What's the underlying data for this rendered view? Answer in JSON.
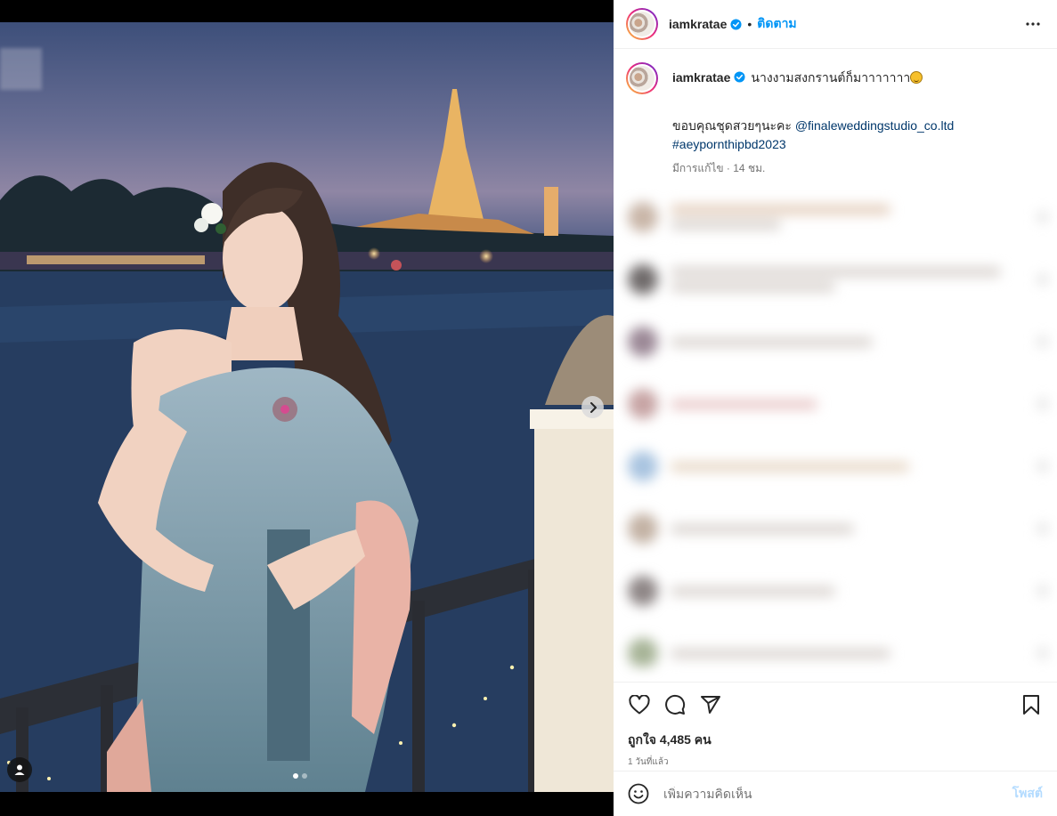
{
  "header": {
    "username": "iamkratae",
    "follow_label": "ติดตาม",
    "more_icon": "more-horizontal-icon"
  },
  "caption": {
    "username": "iamkratae",
    "text": "นางงามสงกรานต์ก็มาาาาาาา",
    "line2_prefix": "ขอบคุณชุดสวยๆนะคะ",
    "mention": "@finaleweddingstudio_co.ltd",
    "hashtag": "#aeypornthipbd2023",
    "meta": "มีการแก้ไข · 14 ชม."
  },
  "actions": {
    "icons": [
      "heart-icon",
      "comment-icon",
      "share-icon",
      "bookmark-icon"
    ],
    "likes": "ถูกใจ 4,485 คน",
    "time": "1 วันที่แล้ว"
  },
  "composer": {
    "placeholder": "เพิ่มความคิดเห็น",
    "post_label": "โพสต์"
  },
  "carousel": {
    "slides": 2,
    "current": 1
  },
  "colors": {
    "accent": "#0095f6",
    "post_disabled": "#b3dbff",
    "link": "#00376b",
    "verified": "#0095f6"
  }
}
